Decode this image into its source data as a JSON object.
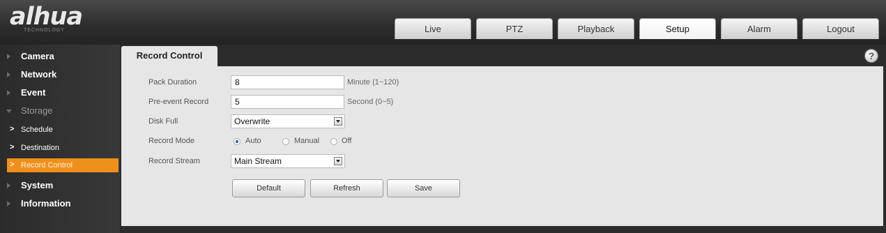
{
  "brand": {
    "logo": "alhua",
    "tagline": "TECHNOLOGY"
  },
  "top_nav": {
    "tabs": [
      "Live",
      "PTZ",
      "Playback",
      "Setup",
      "Alarm",
      "Logout"
    ],
    "active": "Setup"
  },
  "sidebar": {
    "items": [
      {
        "label": "Camera"
      },
      {
        "label": "Network"
      },
      {
        "label": "Event"
      },
      {
        "label": "Storage",
        "expanded": true
      },
      {
        "label": "System"
      },
      {
        "label": "Information"
      }
    ],
    "sub_items": [
      {
        "label": "Schedule"
      },
      {
        "label": "Destination"
      },
      {
        "label": "Record Control",
        "active": true
      }
    ]
  },
  "page": {
    "title": "Record Control",
    "help": "?"
  },
  "form": {
    "pack_duration": {
      "label": "Pack Duration",
      "value": "8",
      "unit": "Minute (1~120)"
    },
    "pre_event_record": {
      "label": "Pre-event Record",
      "value": "5",
      "unit": "Second (0~5)"
    },
    "disk_full": {
      "label": "Disk Full",
      "value": "Overwrite"
    },
    "record_mode": {
      "label": "Record Mode",
      "options": [
        "Auto",
        "Manual",
        "Off"
      ],
      "selected": "Auto"
    },
    "record_stream": {
      "label": "Record Stream",
      "value": "Main Stream"
    }
  },
  "buttons": {
    "default": "Default",
    "refresh": "Refresh",
    "save": "Save"
  },
  "colors": {
    "active_sidebar": "#f0901c",
    "header": "#2c2c2c",
    "panel": "#e6e6e6"
  }
}
